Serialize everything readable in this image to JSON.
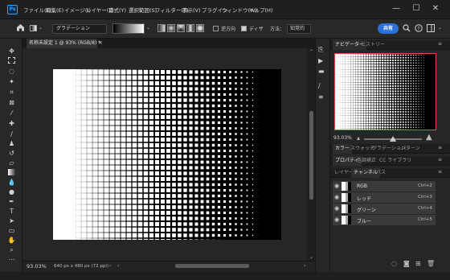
{
  "app": {
    "logo": "Ps"
  },
  "menu": [
    "ファイル(F)",
    "編集(E)",
    "イメージ(I)",
    "レイヤー(L)",
    "書式(Y)",
    "選択範囲(S)",
    "フィルター(T)",
    "表示(V)",
    "プラグイン",
    "ウィンドウ(W)",
    "ヘルプ(H)"
  ],
  "window_controls": {
    "minimize": "—",
    "maximize": "☐",
    "close": "✕"
  },
  "options": {
    "gradient_type": "グラデーション",
    "reverse_label": "逆方向",
    "dither_label": "ディザ",
    "method_label": "方法：",
    "method_value": "知覚的",
    "share_label": "共有"
  },
  "document": {
    "tab_title": "名称未設定 1 @ 93% (RGB/8) *"
  },
  "status": {
    "zoom": "93.03%",
    "size": "640 px x 480 px (72 ppi)"
  },
  "panels": {
    "nav_tabs": [
      "ナビゲーター",
      "ヒストリー"
    ],
    "nav_zoom": "93.03%",
    "color_tabs": [
      "カラー",
      "スウォッチ",
      "グラデーション",
      "パターン"
    ],
    "prop_tabs": [
      "プロパティ",
      "色調補正",
      "CC ライブラリ"
    ],
    "layer_tabs": [
      "レイヤー",
      "チャンネル",
      "パス"
    ],
    "channels": [
      {
        "name": "RGB",
        "shortcut": "Ctrl+2"
      },
      {
        "name": "レッド",
        "shortcut": "Ctrl+3"
      },
      {
        "name": "グリーン",
        "shortcut": "Ctrl+4"
      },
      {
        "name": "ブルー",
        "shortcut": "Ctrl+5"
      }
    ]
  },
  "colors": {
    "accent": "#2a72d8",
    "nav_frame": "#e34b4b",
    "logo": "#31a8ff"
  },
  "icons": {
    "home": "home-icon",
    "search": "search-icon",
    "help": "help-icon",
    "workspace": "workspace-icon"
  }
}
